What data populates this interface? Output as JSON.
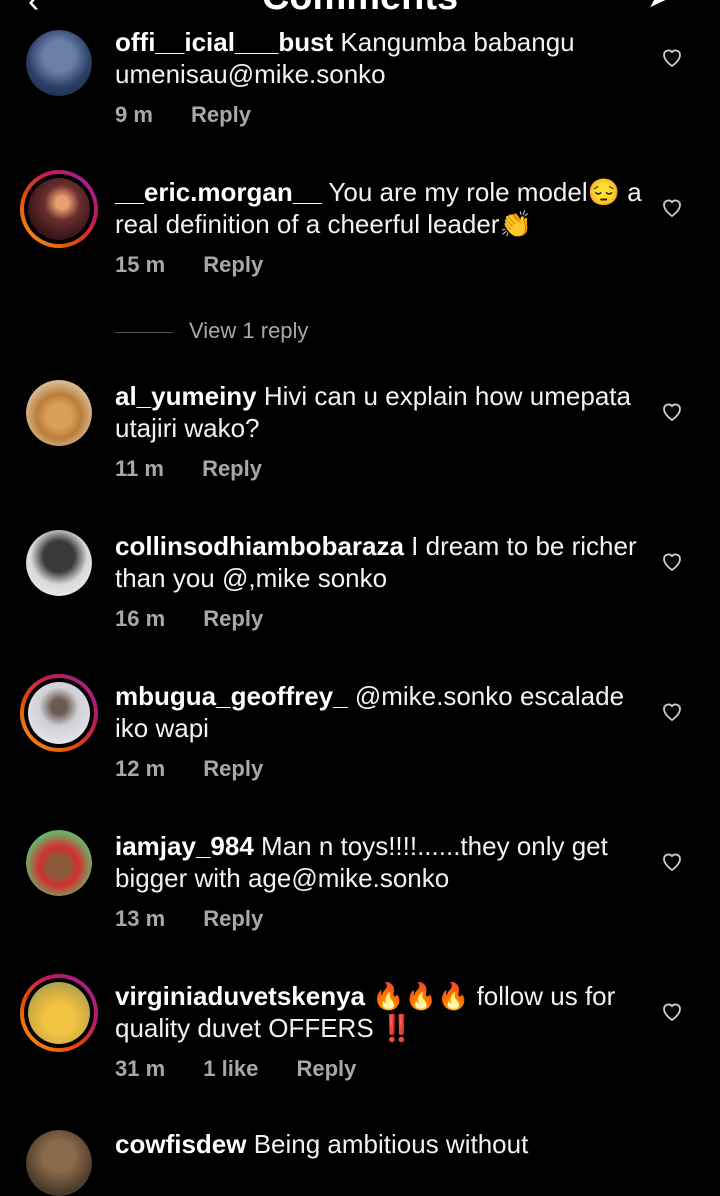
{
  "header": {
    "title": "Comments",
    "back_icon": "back-arrow-icon",
    "send_icon": "send-icon"
  },
  "comments": [
    {
      "user": "offi__icial___bust",
      "text": " Kangumba babangu umenisau@mike.sonko",
      "time": "9 m",
      "reply": "Reply",
      "likes": ""
    },
    {
      "user": "__eric.morgan__",
      "text": " You are my role model😔 a real definition of a cheerful leader👏",
      "time": "15 m",
      "reply": "Reply",
      "likes": ""
    },
    {
      "user": "al_yumeiny",
      "text": " Hivi can u explain how umepata utajiri wako?",
      "time": "11 m",
      "reply": "Reply",
      "likes": ""
    },
    {
      "user": "collinsodhiambobaraza",
      "text": " I dream to be richer than you @,mike sonko",
      "time": "16 m",
      "reply": "Reply",
      "likes": ""
    },
    {
      "user": "mbugua_geoffrey_",
      "text": " @mike.sonko escalade iko wapi",
      "time": "12 m",
      "reply": "Reply",
      "likes": ""
    },
    {
      "user": "iamjay_984",
      "text": " Man n toys!!!!......they only get bigger with age@mike.sonko",
      "time": "13 m",
      "reply": "Reply",
      "likes": ""
    },
    {
      "user": "virginiaduvetskenya",
      "text": " 🔥🔥🔥 follow us for quality duvet OFFERS ‼️",
      "time": "31 m",
      "reply": "Reply",
      "likes": "1 like"
    },
    {
      "user": "cowfisdew",
      "text": " Being ambitious without",
      "time": "",
      "reply": "",
      "likes": ""
    }
  ],
  "view_replies": "View 1 reply",
  "colors": {
    "background": "#000000",
    "muted": "#a8a8a8",
    "ring": "#e65100"
  }
}
